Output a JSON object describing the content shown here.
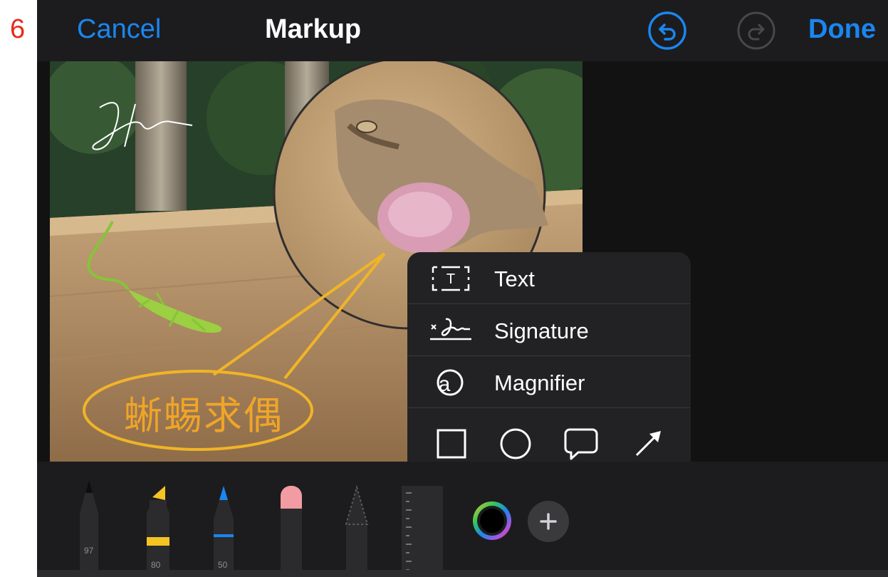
{
  "step_number": "6",
  "navbar": {
    "cancel_label": "Cancel",
    "title": "Markup",
    "undo_icon": "undo-icon",
    "redo_icon": "redo-icon",
    "done_label": "Done"
  },
  "photo": {
    "overlay_caption": "蜥蜴求偶"
  },
  "add_menu": {
    "items": [
      {
        "label": "Text",
        "icon": "text-box-icon"
      },
      {
        "label": "Signature",
        "icon": "signature-icon"
      },
      {
        "label": "Magnifier",
        "icon": "magnifier-icon"
      }
    ],
    "shapes": [
      "square-icon",
      "circle-icon",
      "speech-bubble-icon",
      "arrow-icon"
    ]
  },
  "toolbar": {
    "tools": [
      {
        "name": "pen",
        "opacity": "97"
      },
      {
        "name": "highlighter",
        "opacity": "80"
      },
      {
        "name": "pencil",
        "opacity": "50"
      },
      {
        "name": "eraser"
      },
      {
        "name": "lasso"
      },
      {
        "name": "ruler"
      }
    ],
    "add_label": "+"
  },
  "colors": {
    "accent": "#1a86f0",
    "background": "#121212",
    "panel": "#1c1c1e",
    "popover": "#222224",
    "annotation": "#f0a528",
    "step_label": "#e8291c"
  }
}
